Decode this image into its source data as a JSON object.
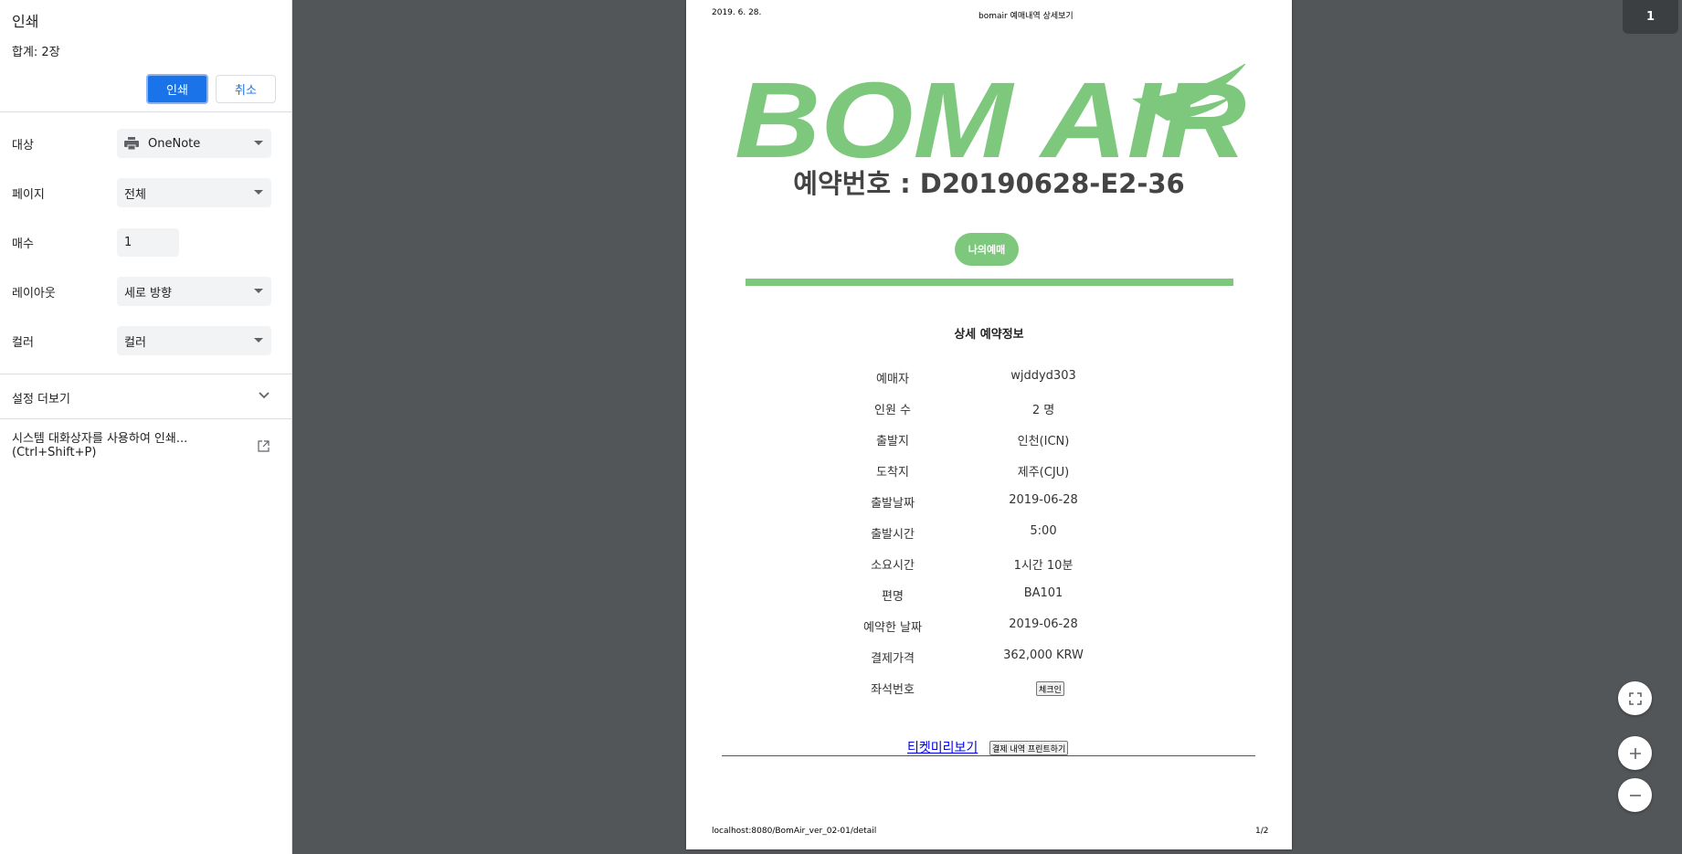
{
  "print_panel": {
    "title": "인쇄",
    "total": "합계: 2장",
    "print_button": "인쇄",
    "cancel_button": "취소",
    "destination": {
      "label": "대상",
      "value": "OneNote"
    },
    "pages": {
      "label": "페이지",
      "value": "전체"
    },
    "copies": {
      "label": "매수",
      "value": "1"
    },
    "layout": {
      "label": "레이아웃",
      "value": "세로 방향"
    },
    "color": {
      "label": "컬러",
      "value": "컬러"
    },
    "more_settings": "설정 더보기",
    "system_dialog_line1": "시스템 대화상자를 사용하여 인쇄...",
    "system_dialog_line2": "(Ctrl+Shift+P)",
    "accent_color": "#1a73e8"
  },
  "preview": {
    "header_date": "2019. 6. 28.",
    "header_title": "bomair 예매내역 상세보기",
    "logo_text": "BOM AIR",
    "brand_color": "#7ec87e",
    "reservation_number": "예약번호 : D20190628-E2-36",
    "my_reservation_button": "나의예매",
    "detail_title": "상세 예약정보",
    "rows": [
      {
        "key": "예매자",
        "value": "wjddyd303"
      },
      {
        "key": "인원 수",
        "value": "2 명"
      },
      {
        "key": "출발지",
        "value": "인천(ICN)"
      },
      {
        "key": "도착지",
        "value": "제주(CJU)"
      },
      {
        "key": "출발날짜",
        "value": "2019-06-28"
      },
      {
        "key": "출발시간",
        "value": "5:00"
      },
      {
        "key": "소요시간",
        "value": "1시간 10분"
      },
      {
        "key": "편명",
        "value": "BA101"
      },
      {
        "key": "예약한 날짜",
        "value": "2019-06-28"
      },
      {
        "key": "결제가격",
        "value": "362,000 KRW"
      },
      {
        "key": "좌석번호",
        "value": ""
      }
    ],
    "checkin_button": "체크인",
    "ticket_link": "티켓미리보기",
    "print_history_button": "결제 내역 프린트하기",
    "footer_url": "localhost:8080/BomAir_ver_02-01/detail",
    "footer_page": "1/2"
  },
  "page_badge": "1",
  "controls": {
    "fit_icon": "fit-to-page-icon",
    "zoom_in_icon": "zoom-in-icon",
    "zoom_out_icon": "zoom-out-icon"
  }
}
